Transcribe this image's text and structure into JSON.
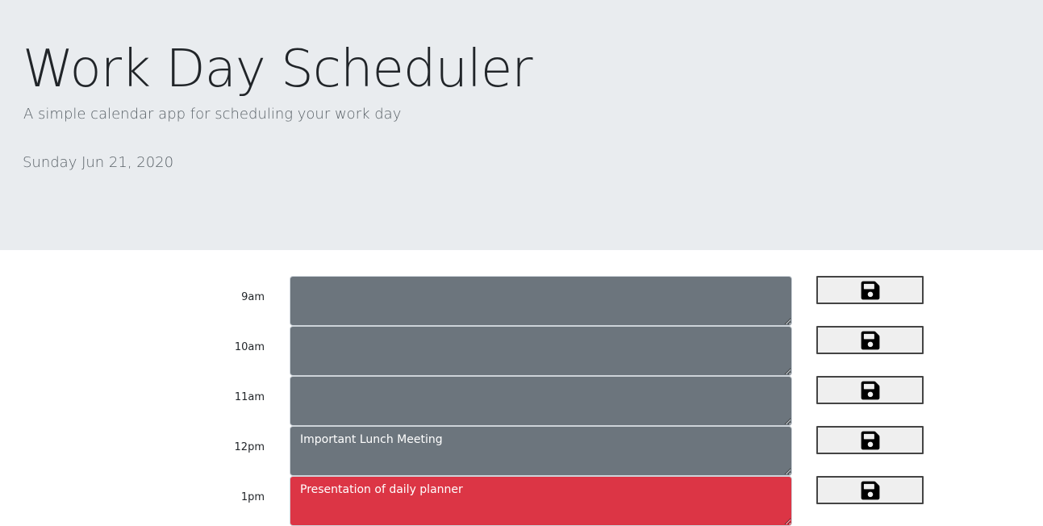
{
  "header": {
    "title": "Work Day Scheduler",
    "subtitle": "A simple calendar app for scheduling your work day",
    "current_day": "Sunday Jun 21, 2020"
  },
  "colors": {
    "past": "#6c757d",
    "present": "#dc3545",
    "header_bg": "#e9ecef"
  },
  "save_icon": "floppy-disk-icon",
  "blocks": [
    {
      "hour": "9am",
      "text": "",
      "state": "past"
    },
    {
      "hour": "10am",
      "text": "",
      "state": "past"
    },
    {
      "hour": "11am",
      "text": "",
      "state": "past"
    },
    {
      "hour": "12pm",
      "text": "Important Lunch Meeting",
      "state": "past"
    },
    {
      "hour": "1pm",
      "text": "Presentation of daily planner",
      "state": "present"
    }
  ]
}
